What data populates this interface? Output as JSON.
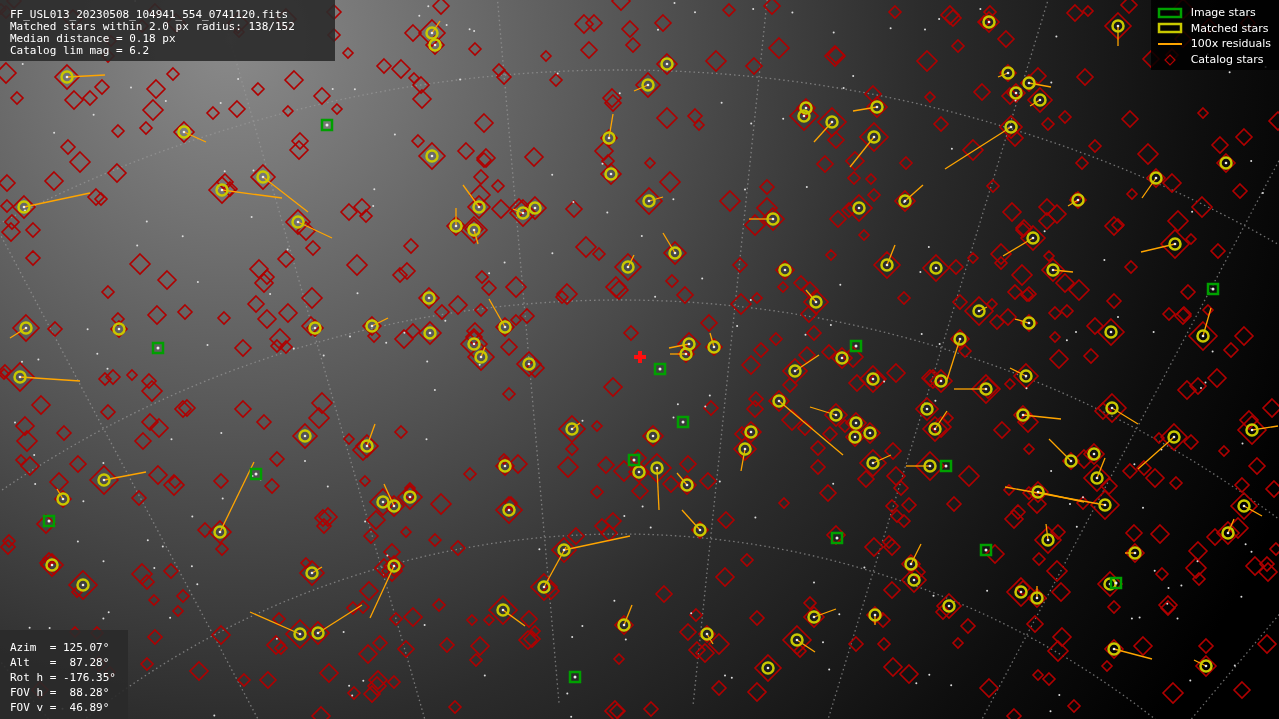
{
  "info_panel": {
    "lines": [
      "FF_USL013_20230508_104941_554_0741120.fits",
      "Matched stars within 2.0 px radius: 138/152",
      "Median distance = 0.18 px",
      "Catalog lim mag = 6.2"
    ]
  },
  "legend": {
    "items": [
      {
        "kind": "square",
        "label": "Image stars",
        "color": "#00a000"
      },
      {
        "kind": "box",
        "label": "Matched stars",
        "color": "#c8c800"
      },
      {
        "kind": "line",
        "label": "100x residuals",
        "color": "#ffa500"
      },
      {
        "kind": "diamond",
        "label": "Catalog stars",
        "color": "#b00000"
      }
    ]
  },
  "pointing_panel": {
    "lines": [
      "Azim  = 125.07°",
      "Alt   =  87.28°",
      "Rot h = -176.35°",
      "FOV h =  88.28°",
      "FOV v =  46.89°"
    ]
  }
}
